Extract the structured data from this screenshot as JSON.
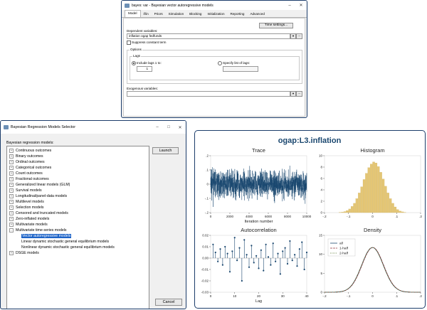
{
  "var_window": {
    "title": "bayes: var - Bayesian vector autoregressive models",
    "tabs": [
      "Model",
      "if/in",
      "Priors",
      "Simulation",
      "Blocking",
      "Initialization",
      "Reporting",
      "Advanced"
    ],
    "time_settings_label": "Time settings...",
    "dep_vars_label": "Dependent variables:",
    "dep_vars_value": "inflation ogap fedfunds",
    "suppress_label": "Suppress constant term",
    "options_label": "Options",
    "lags_label": "Lags",
    "include_lags_label": "Include lags 1 to:",
    "lags_value": "1",
    "specify_lags_label": "Specify list of lags:",
    "exog_label": "Exogenous variables:",
    "browse_label": "..."
  },
  "selector_window": {
    "title": "Bayesian Regression Models Selector",
    "section_label": "Bayesian regression models:",
    "launch_label": "Launch",
    "cancel_label": "Cancel",
    "items": [
      {
        "label": "Continuous outcomes",
        "expander": "+"
      },
      {
        "label": "Binary outcomes",
        "expander": "+"
      },
      {
        "label": "Ordinal outcomes",
        "expander": "+"
      },
      {
        "label": "Categorical outcomes",
        "expander": "+"
      },
      {
        "label": "Count outcomes",
        "expander": "+"
      },
      {
        "label": "Fractional outcomes",
        "expander": "+"
      },
      {
        "label": "Generalized linear models (GLM)",
        "expander": "+"
      },
      {
        "label": "Survival models",
        "expander": "+"
      },
      {
        "label": "Longitudinal/panel-data models",
        "expander": "+"
      },
      {
        "label": "Multilevel models",
        "expander": "+"
      },
      {
        "label": "Selection models",
        "expander": "+"
      },
      {
        "label": "Censored and truncated models",
        "expander": "+"
      },
      {
        "label": "Zero-inflated models",
        "expander": "+"
      },
      {
        "label": "Multivariate models",
        "expander": "+"
      },
      {
        "label": "Multivariate time-series models",
        "expander": "-"
      },
      {
        "label": "Vector autoregressive models",
        "expander": "",
        "selected": true
      },
      {
        "label": "Linear dynamic stochastic general equilibrium models",
        "expander": ""
      },
      {
        "label": "Nonlinear dynamic stochastic general equilibrium models",
        "expander": ""
      },
      {
        "label": "DSGE models",
        "expander": "+"
      }
    ]
  },
  "graph": {
    "title": "ogap:L3.inflation",
    "accent": "#1a476f",
    "hist_color": "#e4c675"
  },
  "chart_data": [
    {
      "type": "line",
      "title": "Trace",
      "xlabel": "Iteration number",
      "ylabel": "",
      "xlim": [
        0,
        10000
      ],
      "ylim": [
        -0.2,
        0.2
      ],
      "xticks": [
        "0",
        "2000",
        "4000",
        "6000",
        "8000",
        "10000"
      ],
      "yticks": [
        "-.2",
        "-.1",
        "0",
        ".1",
        ".2"
      ],
      "series": [
        {
          "name": "",
          "noise_sd": 0.045,
          "mean": 0.0
        }
      ]
    },
    {
      "type": "bar",
      "title": "Histogram",
      "xlabel": "",
      "ylabel": "",
      "xlim": [
        -0.2,
        0.2
      ],
      "ylim": [
        0,
        11
      ],
      "xticks": [
        "-.2",
        "-.1",
        "0",
        ".1",
        ".2"
      ],
      "yticks": [
        "0",
        "2",
        "4",
        "6",
        "8",
        "10"
      ],
      "bin_width": 0.01,
      "bins": [
        -0.14,
        -0.13,
        -0.12,
        -0.11,
        -0.1,
        -0.09,
        -0.08,
        -0.07,
        -0.06,
        -0.05,
        -0.04,
        -0.03,
        -0.02,
        -0.01,
        0.0,
        0.01,
        0.02,
        0.03,
        0.04,
        0.05,
        0.06,
        0.07,
        0.08,
        0.09,
        0.1,
        0.11,
        0.12,
        0.13
      ],
      "values": [
        0.05,
        0.1,
        0.2,
        0.4,
        0.7,
        1.2,
        1.8,
        2.7,
        3.8,
        5.0,
        6.4,
        7.6,
        8.7,
        9.4,
        9.8,
        9.6,
        8.9,
        7.8,
        6.5,
        5.1,
        3.8,
        2.7,
        1.8,
        1.1,
        0.6,
        0.3,
        0.15,
        0.05
      ]
    },
    {
      "type": "scatter",
      "title": "Autocorrelation",
      "xlabel": "Lag",
      "ylabel": "",
      "xlim": [
        0,
        40
      ],
      "ylim": [
        -0.03,
        0.02
      ],
      "xticks": [
        "0",
        "10",
        "20",
        "30",
        "40"
      ],
      "yticks": [
        "-0.03",
        "-0.02",
        "-0.01",
        "0.00",
        "0.01",
        "0.02"
      ],
      "x": [
        1,
        2,
        3,
        4,
        5,
        6,
        7,
        8,
        9,
        10,
        11,
        12,
        13,
        14,
        15,
        16,
        17,
        18,
        19,
        20,
        21,
        22,
        23,
        24,
        25,
        26,
        27,
        28,
        29,
        30,
        31,
        32,
        33,
        34,
        35,
        36,
        37,
        38,
        39,
        40
      ],
      "values": [
        0.012,
        0.005,
        -0.003,
        0.008,
        -0.006,
        0.01,
        0.004,
        -0.012,
        0.006,
        0.018,
        -0.002,
        0.009,
        -0.02,
        0.016,
        0.003,
        -0.008,
        0.011,
        -0.004,
        0.002,
        -0.009,
        0.007,
        -0.011,
        0.012,
        0.001,
        -0.006,
        0.013,
        -0.003,
        0.004,
        -0.014,
        0.006,
        0.009,
        -0.005,
        0.015,
        -0.002,
        0.003,
        -0.007,
        0.008,
        0.014,
        -0.01,
        0.005
      ]
    },
    {
      "type": "line",
      "title": "Density",
      "xlabel": "",
      "ylabel": "",
      "xlim": [
        -0.2,
        0.2
      ],
      "ylim": [
        0,
        15
      ],
      "xticks": [
        "-.2",
        "-.1",
        "0",
        ".1",
        ".2"
      ],
      "yticks": [
        "0",
        "5",
        "10",
        "15"
      ],
      "legend": "top-left",
      "series": [
        {
          "name": "all",
          "mean": 0.0,
          "sd": 0.045,
          "color": "#1a476f",
          "dash": ""
        },
        {
          "name": "1-half",
          "mean": 0.001,
          "sd": 0.045,
          "color": "#90353b",
          "dash": "3,1"
        },
        {
          "name": "2-half",
          "mean": -0.001,
          "sd": 0.045,
          "color": "#55752f",
          "dash": "1,1"
        }
      ]
    }
  ]
}
